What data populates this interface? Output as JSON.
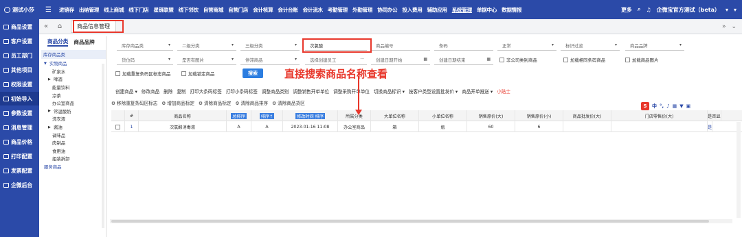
{
  "topnav": {
    "brand": "测试小莎",
    "items": [
      "进销存",
      "出纳管理",
      "线上商城",
      "线下门店",
      "星链联盟",
      "线下邻饮",
      "自营商城",
      "自营门店",
      "会计核算",
      "会计台账",
      "会计流水",
      "考勤管理",
      "外勤管理",
      "协同办公",
      "投入费用",
      "辅助应用",
      "系统管理",
      "单据中心",
      "数据情报"
    ],
    "active_index": 16,
    "more": "更多",
    "company": "企微宝官方测试（beta）"
  },
  "sidebar": [
    "商品设置",
    "客户设置",
    "员工部门",
    "其他项目",
    "权限设置",
    "初始导入",
    "参数设置",
    "消息管理",
    "商品价格",
    "打印配置",
    "发票配置",
    "企微后台"
  ],
  "sidebar_active": 5,
  "tab": {
    "label": "商品信息管理"
  },
  "category": {
    "tabs": [
      "商品分类",
      "商品品牌"
    ],
    "head": "库存商品类",
    "items": [
      {
        "label": "实物商品",
        "level": 0,
        "open": true,
        "color": "#2b4aa8"
      },
      {
        "label": "矿泉水",
        "level": 2
      },
      {
        "label": "啤酒",
        "level": 1,
        "closed": true
      },
      {
        "label": "能量饮料",
        "level": 2
      },
      {
        "label": "凉茶",
        "level": 2
      },
      {
        "label": "办公室商品",
        "level": 2
      },
      {
        "label": "常温酸奶",
        "level": 1,
        "closed": true
      },
      {
        "label": "洗衣液",
        "level": 2
      },
      {
        "label": "酱油",
        "level": 1,
        "closed": true
      },
      {
        "label": "调味品",
        "level": 2
      },
      {
        "label": "肉制品",
        "level": 2
      },
      {
        "label": "食用油",
        "level": 2
      },
      {
        "label": "组装拆卸",
        "level": 2
      },
      {
        "label": "服务商品",
        "level": 0,
        "color": "#2b4aa8"
      }
    ]
  },
  "filters": {
    "row1": [
      "库存商品类",
      "二级分类",
      "三级分类",
      "次氯酸",
      "商品编号",
      "条码",
      "正常",
      "标识过滤",
      "商品品牌"
    ],
    "row2": [
      "货位码",
      "是否有图片",
      "停滞商品",
      "选择创建员工",
      "创建日期开始",
      "创建日期结束"
    ],
    "row2_checks": [
      "非公司类别商品",
      "加载相同条码商品",
      "加载商品图片"
    ],
    "row3_checks": [
      "加载重复条码区标志商品",
      "加载锁定商品"
    ],
    "search": "搜索"
  },
  "annotation": "直接搜索商品名称查看",
  "toolbar1": [
    "创建商品 ▾",
    "修改商品",
    "删除",
    "复制",
    "打印大条码标签",
    "打印小条码标签",
    "调整商品类别",
    "调整销售开单单位",
    "调整采购开单单位",
    "切换商品标识 ▾",
    "按客户类型设置批发价 ▾",
    "商品开单推送 ▾",
    "小贴士"
  ],
  "toolbar2": [
    "移除重复条码区标志",
    "增加商品标定",
    "清除商品标定",
    "清除商品排序",
    "清除商品货区"
  ],
  "ime": {
    "label": "中"
  },
  "grid": {
    "headers": [
      "#",
      "商品名称",
      "总排序",
      "排序↑",
      "修改时间 排序",
      "所属分类",
      "大单位名称",
      "小单位名称",
      "销售原价(大)",
      "销售原价(小)",
      "商品批发价(大)",
      "门店零售价(大)",
      "是否显"
    ],
    "rows": [
      {
        "no": "1",
        "name": "次氯酸消毒液",
        "a": "A",
        "b": "A",
        "time": "2023-01-16 11:08",
        "cat": "办公室商品",
        "big": "箱",
        "small": "瓶",
        "p1": "60",
        "p2": "6",
        "p3": "",
        "p4": "",
        "show": "是"
      }
    ]
  }
}
